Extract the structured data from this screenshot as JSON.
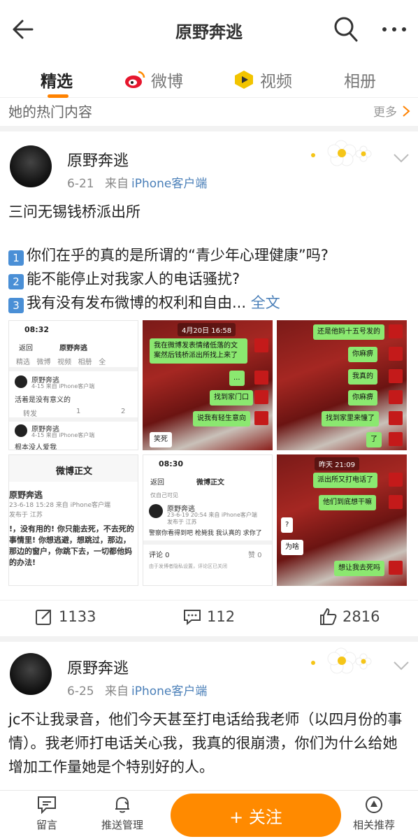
{
  "header": {
    "title": "原野奔逃"
  },
  "tabs": [
    {
      "label": "精选"
    },
    {
      "label": "微博"
    },
    {
      "label": "视频"
    },
    {
      "label": "相册"
    }
  ],
  "hot": {
    "label": "她的热门内容",
    "more": "更多"
  },
  "post1": {
    "user": "原野奔逃",
    "date": "6-21",
    "from": "来自",
    "source": "iPhone客户端",
    "line1": "三问无锡钱桥派出所",
    "q1": "你们在乎的真的是所谓的“青少年心理健康”吗?",
    "q2": "能不能停止对我家人的电话骚扰?",
    "q3": "我有没有发布微博的权利和自由...",
    "q1_num": "1",
    "q2_num": "2",
    "q3_num": "3",
    "fulltext": "全文",
    "reposts": "1133",
    "comments": "112",
    "likes": "2816"
  },
  "images": {
    "img1": {
      "time": "08:32",
      "nav_back": "返回",
      "nav_title": "原野奔逃",
      "tabs": [
        "精选",
        "微博",
        "视频",
        "相册",
        "全"
      ],
      "user_a": "原野奔逃",
      "meta_a": "4-15 来自 iPhone客户端",
      "text_a": "活着是没有意义的",
      "repost_label": "转发",
      "comment_count": "1",
      "like_count": "2",
      "user_b": "原野奔逃",
      "meta_b": "4-15 来自 iPhone客户端",
      "text_b": "根本没人爱我",
      "body_title": "微博正文",
      "user_c": "原野奔逃",
      "meta_c": "23-6-18 15:28 来自 iPhone客户端",
      "loc_c": "发布于 江苏",
      "body_c": "!，没有用的! 你只能去死，不去死的事情里! 你想逃避，想跳过，那边，那边的窗户，你跳下去，一切都他妈的办法!"
    },
    "img2": {
      "ts": "4月20日 16:58",
      "b1": "我在微博发表情绪低落的文案然后钱桥派出所找上来了",
      "b2": "...",
      "b3": "找到家门口",
      "b4": "说我有轻生意向",
      "b5": "笑死"
    },
    "img3": {
      "b1": "还是他妈十五号发的",
      "b2": "你麻痹",
      "b3": "我真的",
      "b4": "你麻痹",
      "b5": "找到家里来憧了",
      "b6": "了"
    },
    "img4": {
      "time": "08:30",
      "nav_back": "返回",
      "nav_title": "微博正文",
      "vis": "仅自己可见",
      "user": "原野奔逃",
      "meta": "23-6-19 20:54 来自 iPhone客户端",
      "loc": "发布于 江苏",
      "body": "警察你看得到吧 枪毙我 我认真的 求你了",
      "comments_label": "评论 0",
      "like_label": "赞 0",
      "notice": "由于发博者隐私设置，评论区已关闭"
    },
    "img5": {
      "ts": "昨天 21:09",
      "b1": "派出所又打电话了",
      "b2": "他们到底想干嘛",
      "b3": "?",
      "b4": "为啥",
      "b5": "想让我去死吗"
    }
  },
  "post2": {
    "user": "原野奔逃",
    "date": "6-25",
    "from": "来自",
    "source": "iPhone客户端",
    "text": "jc不让我录音，他们今天甚至打电话给我老师（以四月份的事情）。我老师打电话关心我，我真的很崩溃，你们为什么给她增加工作量她是个特别好的人。"
  },
  "bottom": {
    "message": "留言",
    "push": "推送管理",
    "follow": "+ 关注",
    "related": "相关推荐"
  },
  "colors": {
    "accent": "#ff8200",
    "link": "#4a7fb8",
    "follow": "#ff8a00"
  }
}
